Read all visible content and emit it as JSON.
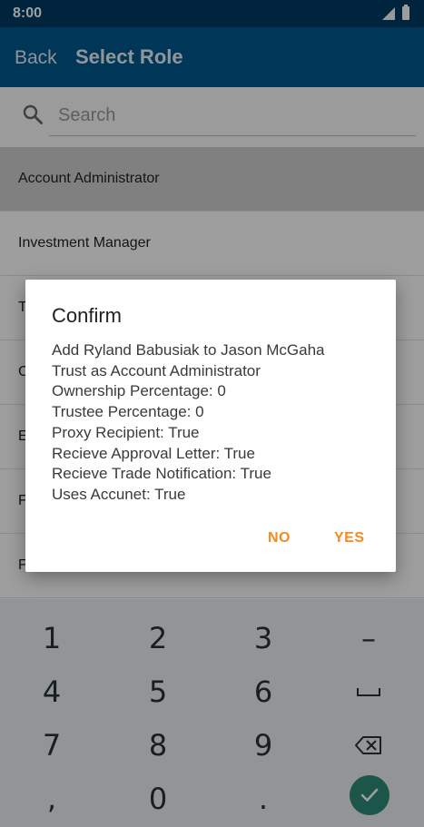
{
  "status_bar": {
    "time": "8:00"
  },
  "app_bar": {
    "back_label": "Back",
    "title": "Select Role"
  },
  "search": {
    "placeholder": "Search",
    "value": ""
  },
  "roles": [
    {
      "label": "Account Administrator",
      "selected": true
    },
    {
      "label": "Investment Manager",
      "selected": false
    },
    {
      "label": "T",
      "selected": false
    },
    {
      "label": "C",
      "selected": false
    },
    {
      "label": "E",
      "selected": false
    },
    {
      "label": "F",
      "selected": false
    },
    {
      "label": "F",
      "selected": false
    }
  ],
  "dialog": {
    "title": "Confirm",
    "lines": [
      "Add Ryland Babusiak to Jason McGaha",
      "Trust as Account Administrator",
      "Ownership Percentage: 0",
      "Trustee Percentage: 0",
      "Proxy Recipient: True",
      "Recieve Approval Letter: True",
      "Recieve Trade Notification: True",
      "Uses Accunet: True"
    ],
    "no_label": "NO",
    "yes_label": "YES"
  },
  "keyboard": {
    "keys": [
      "1",
      "2",
      "3",
      "–",
      "4",
      "5",
      "6",
      "␣",
      "7",
      "8",
      "9",
      "⌫",
      ",",
      "0",
      "."
    ],
    "enter_icon": "check-icon"
  },
  "colors": {
    "status_bar": "#013a63",
    "app_bar": "#01578f",
    "accent": "#f5891f",
    "enter_key": "#2e8a76"
  }
}
